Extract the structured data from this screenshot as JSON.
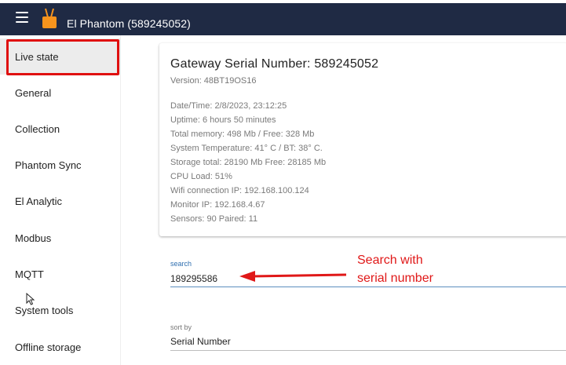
{
  "header": {
    "title": "El Phantom (589245052)",
    "menu_icon": "hamburger-menu-icon",
    "logo_icon": "router-logo-icon",
    "logo_color": "#f7941d",
    "bg_color": "#1f2a44"
  },
  "sidebar": {
    "items": [
      {
        "label": "Live state",
        "active": true
      },
      {
        "label": "General"
      },
      {
        "label": "Collection"
      },
      {
        "label": "Phantom Sync"
      },
      {
        "label": "El Analytic"
      },
      {
        "label": "Modbus"
      },
      {
        "label": "MQTT"
      },
      {
        "label": "System tools"
      },
      {
        "label": "Offline storage"
      }
    ]
  },
  "gateway": {
    "title": "Gateway Serial Number: 589245052",
    "version": "Version: 48BT19OS16",
    "info": [
      "Date/Time: 2/8/2023, 23:12:25",
      "Uptime: 6 hours 50 minutes",
      "Total memory: 498 Mb / Free: 328 Mb",
      "System Temperature: 41° C / BT: 38° C.",
      "Storage total: 28190 Mb Free: 28185 Mb",
      "CPU Load: 51%",
      "Wifi connection IP: 192.168.100.124",
      "Monitor IP: 192.168.4.67",
      "Sensors: 90 Paired: 11"
    ]
  },
  "search": {
    "label": "search",
    "value": "189295586"
  },
  "annotation": {
    "line1": "Search with",
    "line2": "serial number",
    "color": "#e01818"
  },
  "sort": {
    "label": "sort by",
    "value": "Serial Number"
  }
}
